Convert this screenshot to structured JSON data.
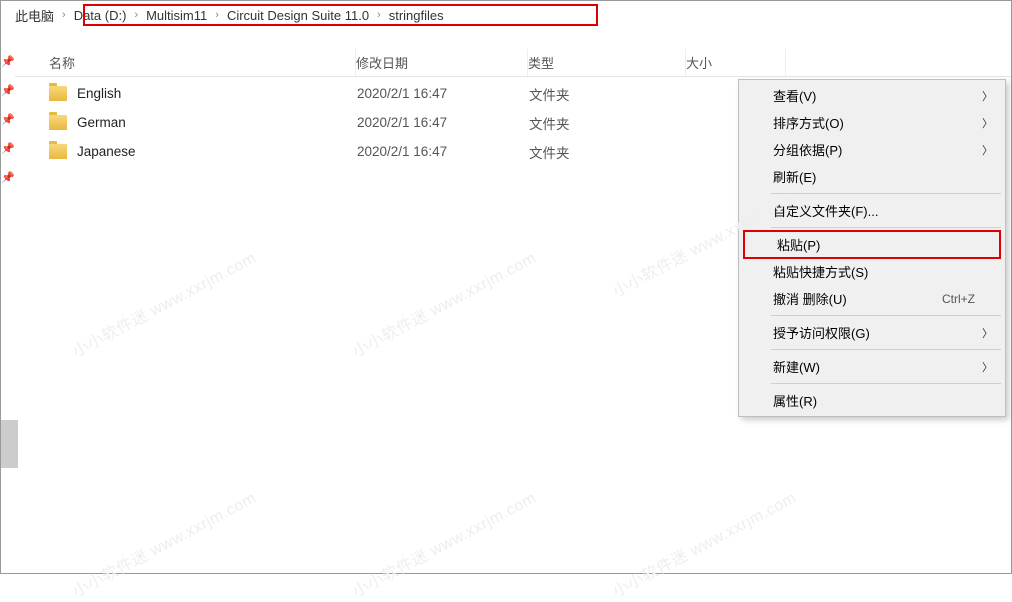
{
  "breadcrumb": {
    "root": "此电脑",
    "parts": [
      "Data (D:)",
      "Multisim11",
      "Circuit Design Suite 11.0",
      "stringfiles"
    ]
  },
  "columns": {
    "name": "名称",
    "date": "修改日期",
    "type": "类型",
    "size": "大小"
  },
  "files": [
    {
      "name": "English",
      "date": "2020/2/1 16:47",
      "type": "文件夹"
    },
    {
      "name": "German",
      "date": "2020/2/1 16:47",
      "type": "文件夹"
    },
    {
      "name": "Japanese",
      "date": "2020/2/1 16:47",
      "type": "文件夹"
    }
  ],
  "menu": {
    "view": "查看(V)",
    "sort": "排序方式(O)",
    "group": "分组依据(P)",
    "refresh": "刷新(E)",
    "customize": "自定义文件夹(F)...",
    "paste": "粘贴(P)",
    "paste_shortcut": "粘贴快捷方式(S)",
    "undo_delete": "撤消 删除(U)",
    "undo_delete_key": "Ctrl+Z",
    "grant_access": "授予访问权限(G)",
    "new": "新建(W)",
    "properties": "属性(R)"
  },
  "watermark": "小小软件迷  www.xxrjm.com"
}
